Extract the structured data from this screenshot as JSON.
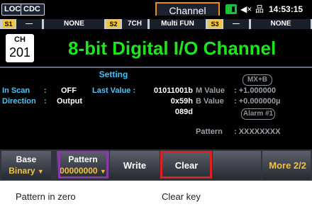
{
  "topbar": {
    "loc": "LOC",
    "cdc": "CDC",
    "screen_title": "Channel",
    "time": "14:53:15",
    "icons": [
      "status-indicator-icon",
      "speaker-mute-icon",
      "network-icon"
    ]
  },
  "slots": [
    {
      "badge": "S1",
      "items": [
        "—",
        "NONE"
      ]
    },
    {
      "badge": "S2",
      "items": [
        "7CH",
        "Multi FUN"
      ]
    },
    {
      "badge": "S3",
      "items": [
        "—",
        "NONE"
      ]
    }
  ],
  "channel": {
    "ch_label": "CH",
    "number": "201",
    "title": "8-bit Digital I/O Channel"
  },
  "settings": {
    "heading": "Setting",
    "in_scan_label": "In Scan",
    "in_scan_value": "OFF",
    "direction_label": "Direction",
    "direction_value": "Output",
    "last_value_label": "Last Value :",
    "last_value_bin": "01011001b",
    "last_value_hex": "0x59h",
    "last_value_dec": "089d",
    "colon": ":"
  },
  "mxb": {
    "label": "MX+B",
    "m_label": "M Value",
    "m_value": ": +1.000000",
    "b_label": "B Value",
    "b_value": ": +0.000000µ",
    "alarm": "Alarm #1",
    "pattern_label": "Pattern",
    "pattern_value": ": XXXXXXXX"
  },
  "softkeys": [
    {
      "title": "Base",
      "sub": "Binary"
    },
    {
      "title": "Pattern",
      "sub": "00000000"
    },
    {
      "title": "Write"
    },
    {
      "title": "Clear"
    },
    {
      "title": ""
    },
    {
      "title": "More 2/2"
    }
  ],
  "captions": {
    "pattern": "Pattern in zero",
    "clear": "Clear key"
  }
}
